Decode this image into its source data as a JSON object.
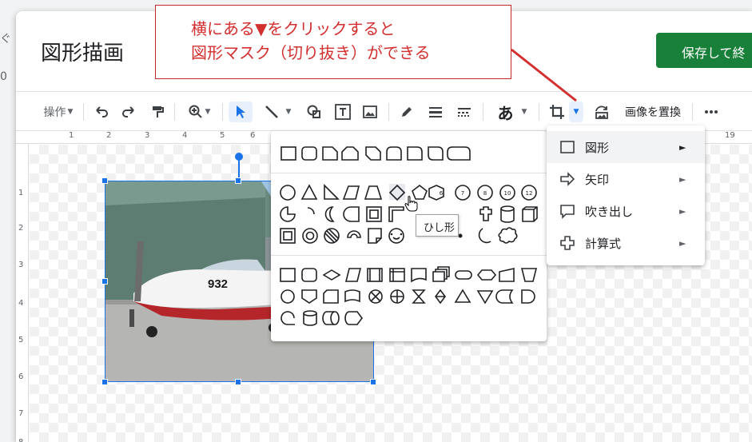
{
  "background_app": {
    "glyph_top": "ぐ",
    "glyph_bottom": "0"
  },
  "dialog": {
    "title": "図形描画",
    "save_button": "保存して終",
    "toolbar": {
      "actions_label": "操作",
      "text_char": "あ",
      "replace_image_label": "画像を置換"
    },
    "ruler_h": [
      "1",
      "2",
      "3",
      "4",
      "5",
      "6",
      "19"
    ],
    "ruler_v": [
      "1",
      "2",
      "3",
      "4",
      "5",
      "6",
      "7",
      "8"
    ]
  },
  "image": {
    "tail_number": "932"
  },
  "callout": {
    "line1": "横にある▼をクリックすると",
    "line2": "図形マスク（切り抜き）ができる"
  },
  "shape_menu": {
    "items": [
      {
        "label": "図形",
        "icon": "square-icon",
        "highlighted": true
      },
      {
        "label": "矢印",
        "icon": "arrow-icon",
        "highlighted": false
      },
      {
        "label": "吹き出し",
        "icon": "callout-icon",
        "highlighted": false
      },
      {
        "label": "計算式",
        "icon": "plus-icon",
        "highlighted": false
      }
    ],
    "submenu_arrow": "►"
  },
  "shapes_panel": {
    "badge_numbers": [
      "6",
      "7",
      "8",
      "10",
      "12"
    ]
  },
  "tooltip": "ひし形",
  "colors": {
    "accent": "#1a73e8",
    "save": "#188038",
    "callout": "#d32f2f"
  }
}
